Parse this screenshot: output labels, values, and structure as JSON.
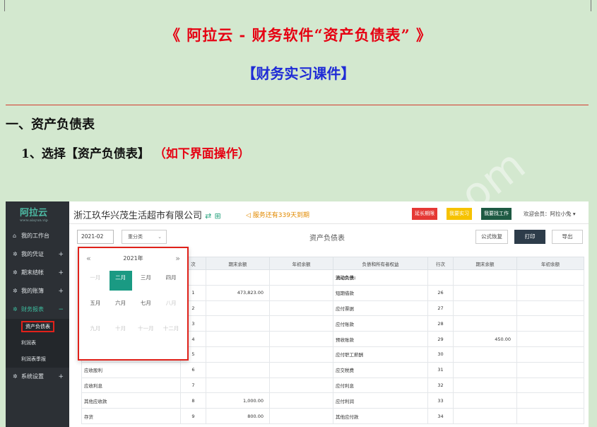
{
  "document": {
    "title": "《 阿拉云 - 财务软件“资产负债表” 》",
    "subtitle": "【财务实习课件】",
    "section_heading": "一、资产负债表",
    "step_heading": "1、选择【资产负债表】",
    "step_note": "（如下界面操作）"
  },
  "app": {
    "logo": "阿拉云",
    "logo_url": "www.alayun.vip",
    "company": "浙江玖华兴茂生活超市有限公司",
    "service_notice": "服务还有339天到期",
    "btn_extend": "延长期限",
    "btn_internship": "我要实习",
    "btn_job": "我要找工作",
    "welcome": "欢迎会员：阿拉小兔 ▾"
  },
  "sidebar": {
    "items": [
      {
        "label": "我的工作台",
        "icon": "home-icon",
        "expand": ""
      },
      {
        "label": "我的凭证",
        "icon": "gear-icon",
        "expand": "+"
      },
      {
        "label": "期末结帐",
        "icon": "gear-icon",
        "expand": "+"
      },
      {
        "label": "我的账簿",
        "icon": "gear-icon",
        "expand": "+"
      },
      {
        "label": "财务报表",
        "icon": "gear-icon",
        "expand": "−"
      }
    ],
    "report_subitems": [
      "资产负债表",
      "利润表",
      "利润表季报"
    ],
    "settings": {
      "label": "系统设置",
      "expand": "+"
    }
  },
  "toolbar": {
    "date_value": "2021-02",
    "category_label": "重分类",
    "sheet_title": "资产负债表",
    "btn_formula": "公式恢复",
    "btn_print": "打印",
    "btn_export": "导出"
  },
  "picker": {
    "year": "2021年",
    "months": [
      "一月",
      "二月",
      "三月",
      "四月",
      "五月",
      "六月",
      "七月",
      "八月",
      "九月",
      "十月",
      "十一月",
      "十二月"
    ],
    "selected": "二月"
  },
  "table": {
    "headers": [
      "",
      "次",
      "期末余额",
      "年初余额",
      "负债和所有者权益",
      "行次",
      "期末余额",
      "年初余额"
    ],
    "rows": [
      [
        "",
        "",
        "",
        "",
        "流动负债:",
        "",
        "",
        ""
      ],
      [
        "",
        "1",
        "473,823.00",
        "",
        "短期借款",
        "26",
        "",
        ""
      ],
      [
        "",
        "2",
        "",
        "",
        "应付票据",
        "27",
        "",
        ""
      ],
      [
        "",
        "3",
        "",
        "",
        "应付账款",
        "28",
        "",
        ""
      ],
      [
        "",
        "4",
        "",
        "",
        "预收账款",
        "29",
        "450.00",
        ""
      ],
      [
        "",
        "5",
        "",
        "",
        "应付职工薪酬",
        "30",
        "",
        ""
      ],
      [
        "应收股利",
        "6",
        "",
        "",
        "应交税费",
        "31",
        "",
        ""
      ],
      [
        "应收利息",
        "7",
        "",
        "",
        "应付利息",
        "32",
        "",
        ""
      ],
      [
        "其他应收款",
        "8",
        "1,000.00",
        "",
        "应付利润",
        "33",
        "",
        ""
      ],
      [
        "存货",
        "9",
        "800.00",
        "",
        "其他应付款",
        "34",
        "",
        ""
      ]
    ]
  },
  "watermark": "om"
}
